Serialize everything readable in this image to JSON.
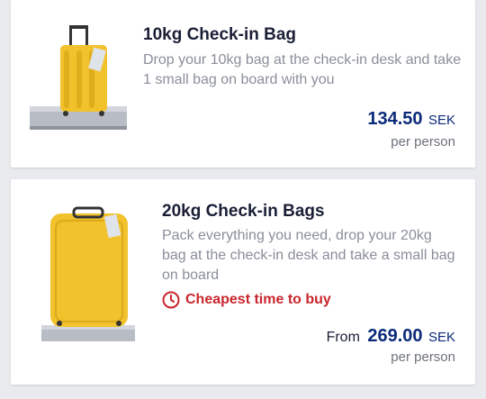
{
  "options": [
    {
      "title": "10kg Check-in Bag",
      "description": "Drop your 10kg bag at the check-in desk and take 1 small bag on board with you",
      "price": "134.50",
      "currency": "SEK",
      "per": "per person"
    },
    {
      "title": "20kg Check-in Bags",
      "description": "Pack everything you need, drop your 20kg bag at the check-in desk and take a small bag on board",
      "badge": "Cheapest time to buy",
      "price_prefix": "From",
      "price": "269.00",
      "currency": "SEK",
      "per": "per person"
    }
  ],
  "icons": {
    "bag1": "hard-suitcase-icon",
    "bag2": "soft-suitcase-icon",
    "badge": "clock-icon"
  },
  "colors": {
    "accent": "#0b2a7a",
    "alert": "#c8262c",
    "bag": "#f2c22c"
  }
}
